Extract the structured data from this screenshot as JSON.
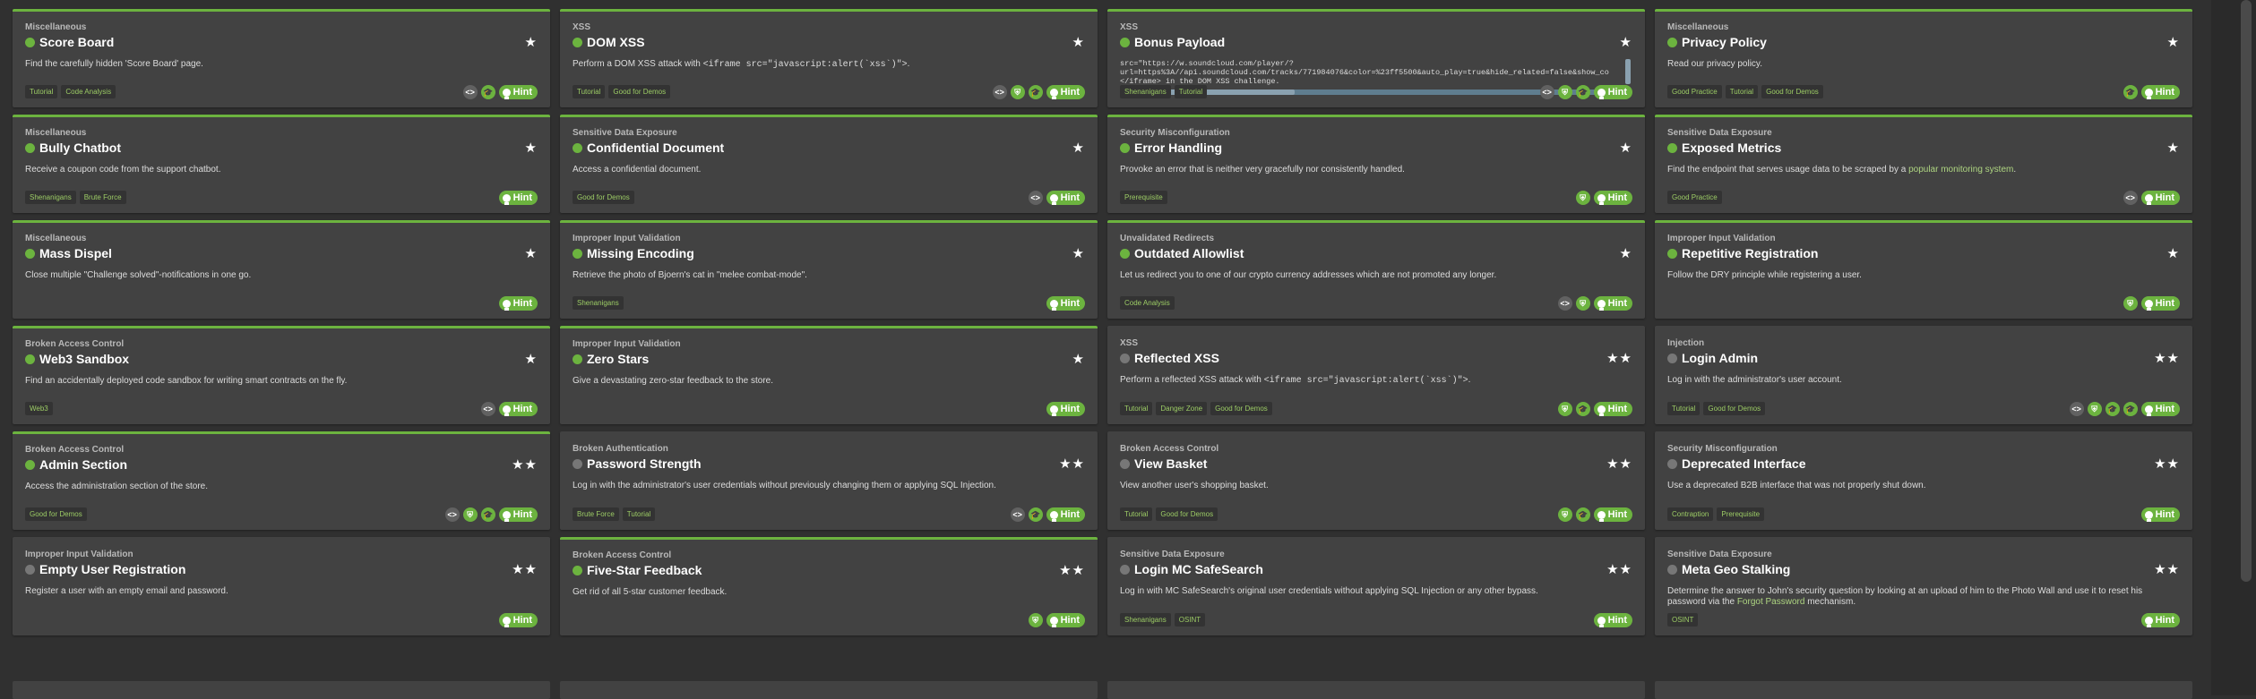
{
  "colors": {
    "accent": "#6cb33f",
    "card": "#424242",
    "background": "#303030",
    "tag_text": "#9ccc65"
  },
  "hint_label": "Hint",
  "challenges": [
    {
      "category": "Miscellaneous",
      "name": "Score Board",
      "stars": "★",
      "solved": true,
      "description": "Find the carefully hidden 'Score Board' page.",
      "tags": [
        "Tutorial",
        "Code Analysis"
      ],
      "actions": [
        "code",
        "mortarboard"
      ]
    },
    {
      "category": "XSS",
      "name": "DOM XSS",
      "stars": "★",
      "solved": true,
      "desc_parts": [
        {
          "t": "Perform a "
        },
        {
          "t": "DOM",
          "c": ""
        },
        {
          "t": " XSS attack with "
        },
        {
          "t": "<iframe src=\"javascript:alert(`xss`)\">",
          "c": "code"
        },
        {
          "t": "."
        }
      ],
      "tags": [
        "Tutorial",
        "Good for Demos"
      ],
      "actions": [
        "code",
        "shield",
        "mortarboard"
      ]
    },
    {
      "category": "XSS",
      "name": "Bonus Payload",
      "stars": "★",
      "solved": true,
      "payload": [
        "src=\"https://w.soundcloud.com/player/?",
        "url=https%3A//api.soundcloud.com/tracks/771984076&color=%23ff5500&auto_play=true&hide_related=false&show_co",
        "</iframe> in the DOM XSS challenge."
      ],
      "tags": [
        "Shenanigans",
        "Tutorial"
      ],
      "actions": [
        "code",
        "shield",
        "mortarboard"
      ]
    },
    {
      "category": "Miscellaneous",
      "name": "Privacy Policy",
      "stars": "★",
      "solved": true,
      "description": "Read our privacy policy.",
      "tags": [
        "Good Practice",
        "Tutorial",
        "Good for Demos"
      ],
      "actions": [
        "mortarboard"
      ]
    },
    {
      "category": "Miscellaneous",
      "name": "Bully Chatbot",
      "stars": "★",
      "solved": true,
      "description": "Receive a coupon code from the support chatbot.",
      "tags": [
        "Shenanigans",
        "Brute Force"
      ],
      "actions": []
    },
    {
      "category": "Sensitive Data Exposure",
      "name": "Confidential Document",
      "stars": "★",
      "solved": true,
      "description": "Access a confidential document.",
      "tags": [
        "Good for Demos"
      ],
      "actions": [
        "code"
      ]
    },
    {
      "category": "Security Misconfiguration",
      "name": "Error Handling",
      "stars": "★",
      "solved": true,
      "description": "Provoke an error that is neither very gracefully nor consistently handled.",
      "tags": [
        "Prerequisite"
      ],
      "actions": [
        "shield"
      ]
    },
    {
      "category": "Sensitive Data Exposure",
      "name": "Exposed Metrics",
      "stars": "★",
      "solved": true,
      "desc_parts": [
        {
          "t": "Find the endpoint that serves usage data to be scraped by a "
        },
        {
          "t": "popular monitoring system",
          "c": "link"
        },
        {
          "t": "."
        }
      ],
      "tags": [
        "Good Practice"
      ],
      "actions": [
        "code"
      ]
    },
    {
      "category": "Miscellaneous",
      "name": "Mass Dispel",
      "stars": "★",
      "solved": true,
      "description": "Close multiple \"Challenge solved\"-notifications in one go.",
      "tags": [],
      "actions": []
    },
    {
      "category": "Improper Input Validation",
      "name": "Missing Encoding",
      "stars": "★",
      "solved": true,
      "description": "Retrieve the photo of Bjoern's cat in \"melee combat-mode\".",
      "tags": [
        "Shenanigans"
      ],
      "actions": []
    },
    {
      "category": "Unvalidated Redirects",
      "name": "Outdated Allowlist",
      "stars": "★",
      "solved": true,
      "description": "Let us redirect you to one of our crypto currency addresses which are not promoted any longer.",
      "tags": [
        "Code Analysis"
      ],
      "actions": [
        "code",
        "shield"
      ]
    },
    {
      "category": "Improper Input Validation",
      "name": "Repetitive Registration",
      "stars": "★",
      "solved": true,
      "desc_parts": [
        {
          "t": "Follow the DRY principle while registering a user."
        }
      ],
      "tags": [],
      "actions": [
        "shield"
      ]
    },
    {
      "category": "Broken Access Control",
      "name": "Web3 Sandbox",
      "stars": "★",
      "solved": true,
      "description": "Find an accidentally deployed code sandbox for writing smart contracts on the fly.",
      "tags": [
        "Web3"
      ],
      "actions": [
        "code"
      ]
    },
    {
      "category": "Improper Input Validation",
      "name": "Zero Stars",
      "stars": "★",
      "solved": true,
      "description": "Give a devastating zero-star feedback to the store.",
      "tags": [],
      "actions": []
    },
    {
      "category": "XSS",
      "name": "Reflected XSS",
      "stars": "★★",
      "solved": false,
      "desc_parts": [
        {
          "t": "Perform a reflected XSS attack with "
        },
        {
          "t": "<iframe src=\"javascript:alert(`xss`)\">",
          "c": "code"
        },
        {
          "t": "."
        }
      ],
      "tags": [
        "Tutorial",
        "Danger Zone",
        "Good for Demos"
      ],
      "actions": [
        "shield",
        "mortarboard"
      ]
    },
    {
      "category": "Injection",
      "name": "Login Admin",
      "stars": "★★",
      "solved": false,
      "description": "Log in with the administrator's user account.",
      "tags": [
        "Tutorial",
        "Good for Demos"
      ],
      "actions": [
        "code",
        "shield",
        "mortarboard",
        "mortarboard"
      ]
    },
    {
      "category": "Broken Access Control",
      "name": "Admin Section",
      "stars": "★★",
      "solved": true,
      "description": "Access the administration section of the store.",
      "tags": [
        "Good for Demos"
      ],
      "actions": [
        "code",
        "shield",
        "mortarboard"
      ]
    },
    {
      "category": "Broken Authentication",
      "name": "Password Strength",
      "stars": "★★",
      "solved": false,
      "description": "Log in with the administrator's user credentials without previously changing them or applying SQL Injection.",
      "tags": [
        "Brute Force",
        "Tutorial"
      ],
      "actions": [
        "code",
        "mortarboard"
      ]
    },
    {
      "category": "Broken Access Control",
      "name": "View Basket",
      "stars": "★★",
      "solved": false,
      "description": "View another user's shopping basket.",
      "tags": [
        "Tutorial",
        "Good for Demos"
      ],
      "actions": [
        "shield",
        "mortarboard"
      ]
    },
    {
      "category": "Security Misconfiguration",
      "name": "Deprecated Interface",
      "stars": "★★",
      "solved": false,
      "description": "Use a deprecated B2B interface that was not properly shut down.",
      "tags": [
        "Contraption",
        "Prerequisite"
      ],
      "actions": []
    },
    {
      "category": "Improper Input Validation",
      "name": "Empty User Registration",
      "stars": "★★",
      "solved": false,
      "description": "Register a user with an empty email and password.",
      "tags": [],
      "actions": []
    },
    {
      "category": "Broken Access Control",
      "name": "Five-Star Feedback",
      "stars": "★★",
      "solved": true,
      "description": "Get rid of all 5-star customer feedback.",
      "tags": [],
      "actions": [
        "shield"
      ]
    },
    {
      "category": "Sensitive Data Exposure",
      "name": "Login MC SafeSearch",
      "stars": "★★",
      "solved": false,
      "description": "Log in with MC SafeSearch's original user credentials without applying SQL Injection or any other bypass.",
      "tags": [
        "Shenanigans",
        "OSINT"
      ],
      "actions": []
    },
    {
      "category": "Sensitive Data Exposure",
      "name": "Meta Geo Stalking",
      "stars": "★★",
      "solved": false,
      "desc_parts": [
        {
          "t": "Determine the answer to John's security question by looking at an upload of him to the Photo Wall and use it to reset his password via the "
        },
        {
          "t": "Forgot Password",
          "c": "link"
        },
        {
          "t": " mechanism."
        }
      ],
      "tags": [
        "OSINT"
      ],
      "actions": []
    }
  ]
}
